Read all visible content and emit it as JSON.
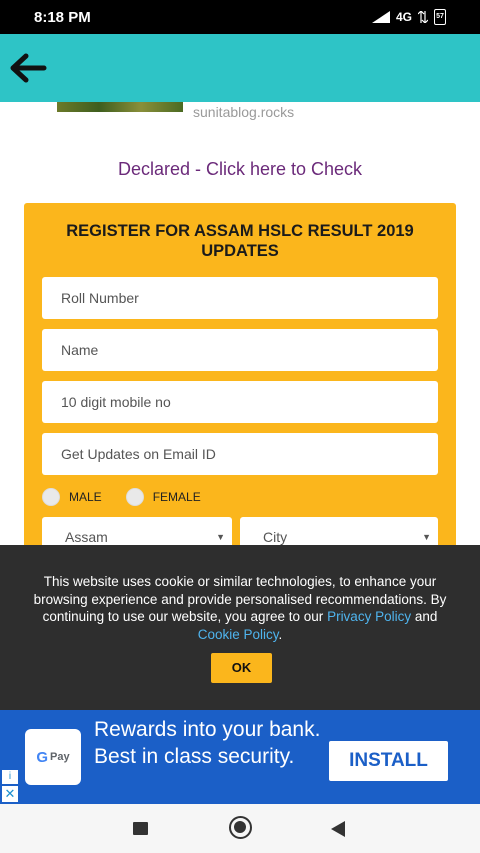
{
  "status_bar": {
    "time": "8:18 PM",
    "network": "4G",
    "battery": "57"
  },
  "app_bar": {
    "back_icon": "arrow-left-icon"
  },
  "article": {
    "site": "sunitablog.rocks",
    "declared_link": "Declared - Click here to Check"
  },
  "form": {
    "title": "REGISTER FOR ASSAM HSLC RESULT 2019 UPDATES",
    "roll_placeholder": "Roll Number",
    "name_placeholder": "Name",
    "mobile_placeholder": "10 digit mobile no",
    "email_placeholder": "Get Updates on Email ID",
    "gender_male": "MALE",
    "gender_female": "FEMALE",
    "state_value": "Assam",
    "city_value": "City"
  },
  "cookie_banner": {
    "text_before": "This website uses cookie or similar technologies, to enhance your browsing experience and provide personalised recommendations. By continuing to use our website, you agree to our ",
    "privacy_link": "Privacy Policy",
    "and_text": " and ",
    "cookie_link": "Cookie Policy",
    "period": ".",
    "ok_label": "OK"
  },
  "ad": {
    "logo_g": "G",
    "logo_pay": "Pay",
    "headline": "Rewards into your bank. Best in class security.",
    "install_label": "INSTALL",
    "info_symbol": "i",
    "close_symbol": "✕"
  },
  "colors": {
    "app_bar": "#2ec4c6",
    "form_bg": "#fbb61c",
    "link_purple": "#6b2a7a",
    "ad_blue": "#1b5fc7",
    "cookie_bg": "#2e2e2e"
  }
}
